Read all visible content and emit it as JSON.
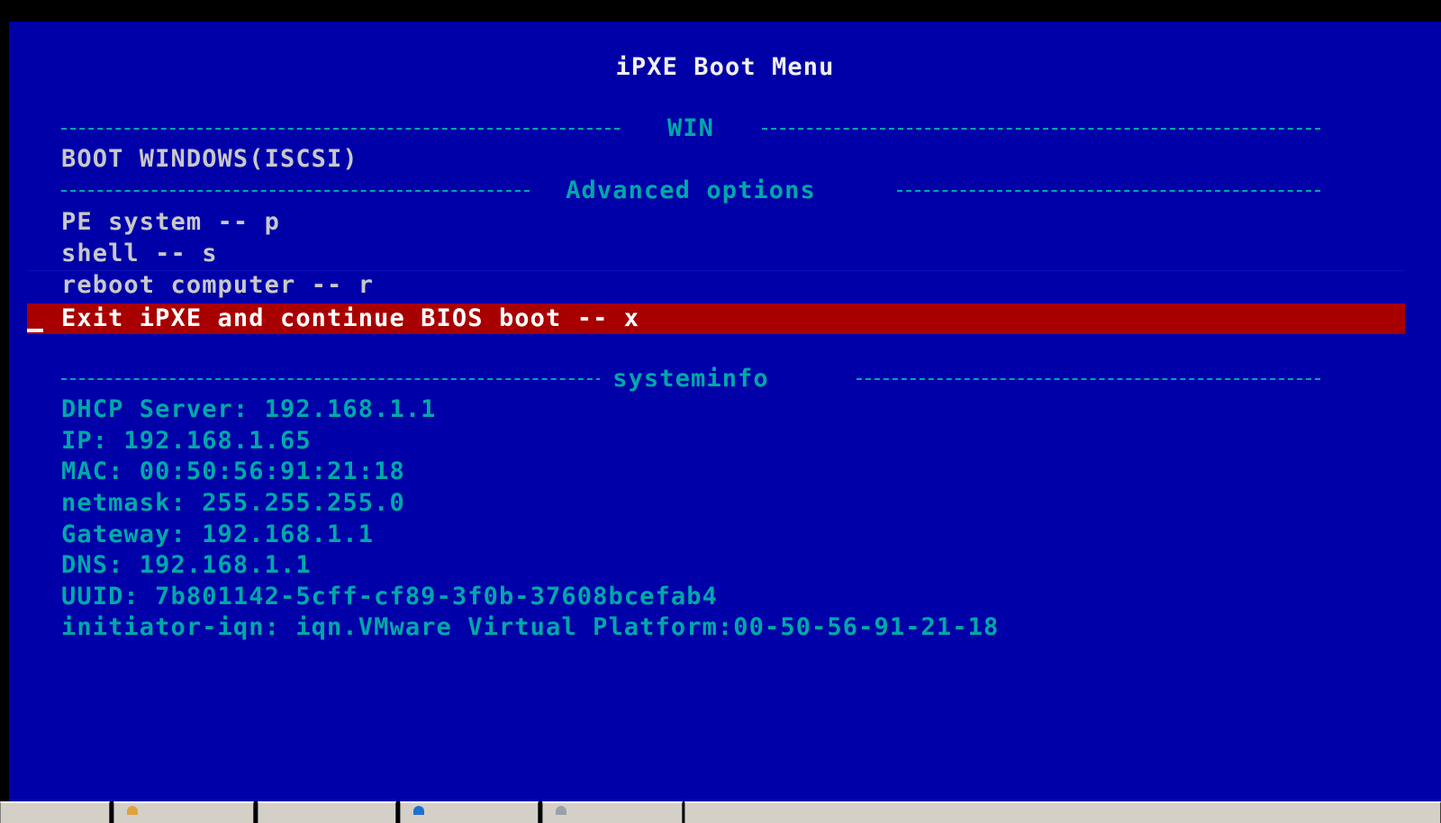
{
  "menu": {
    "title": "iPXE Boot Menu",
    "sections": [
      {
        "label": "WIN"
      },
      {
        "label": "Advanced options"
      },
      {
        "label": "systeminfo"
      }
    ],
    "items": {
      "boot_windows": "BOOT WINDOWS(ISCSI)",
      "pe_system": "PE system -- p",
      "shell": "shell -- s",
      "reboot": "reboot computer -- r",
      "exit": "Exit iPXE and continue BIOS boot -- x"
    },
    "selected_item": "exit"
  },
  "systeminfo": {
    "dhcp_server": "DHCP Server: 192.168.1.1",
    "ip": "IP: 192.168.1.65",
    "mac": "MAC: 00:50:56:91:21:18",
    "netmask": "netmask: 255.255.255.0",
    "gateway": "Gateway: 192.168.1.1",
    "dns": "DNS: 192.168.1.1",
    "uuid": "UUID: 7b801142-5cff-cf89-3f0b-37608bcefab4",
    "initiator_iqn": "initiator-iqn: iqn.VMware Virtual Platform:00-50-56-91-21-18"
  },
  "colors": {
    "background": "#0000a8",
    "title_text": "#f0f0f0",
    "item_text": "#c8c8c8",
    "section_text": "#00a8a8",
    "selection_bar": "#a80000",
    "selection_text": "#ffffff"
  },
  "taskbar": {
    "buttons": [
      {
        "icon": "window-icon"
      },
      {
        "icon": "folder-icon"
      },
      {
        "icon": "window-icon"
      },
      {
        "icon": "browser-icon"
      },
      {
        "icon": "app-icon"
      }
    ]
  }
}
